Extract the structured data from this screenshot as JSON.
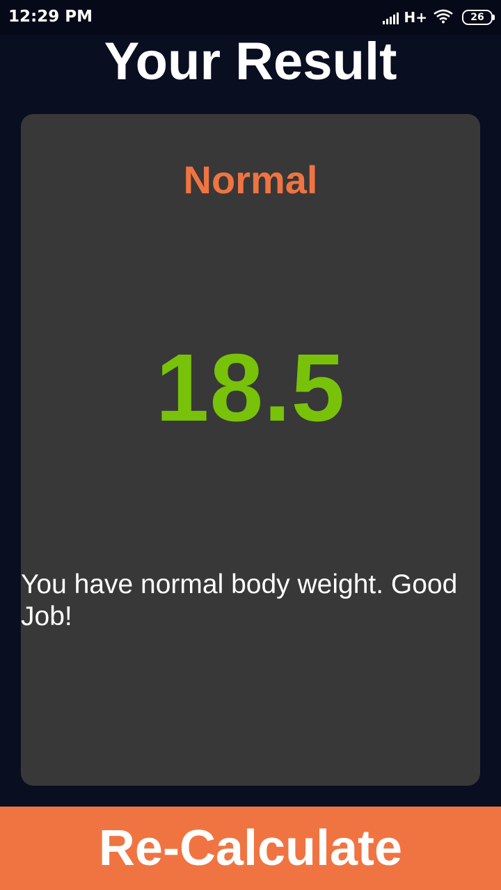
{
  "status_bar": {
    "time": "12:29 PM",
    "network": "H+",
    "battery_level": "26",
    "icons": [
      "signal-icon",
      "wifi-icon",
      "battery-icon"
    ]
  },
  "page": {
    "title": "Your Result"
  },
  "result": {
    "category": "Normal",
    "bmi": "18.5",
    "message": "You have normal body weight. Good Job!"
  },
  "actions": {
    "recalculate_label": "Re-Calculate"
  },
  "colors": {
    "background": "#0a0e21",
    "card": "#383838",
    "accent": "#f07441",
    "bmi_value": "#78c20a",
    "text": "#ffffff"
  }
}
